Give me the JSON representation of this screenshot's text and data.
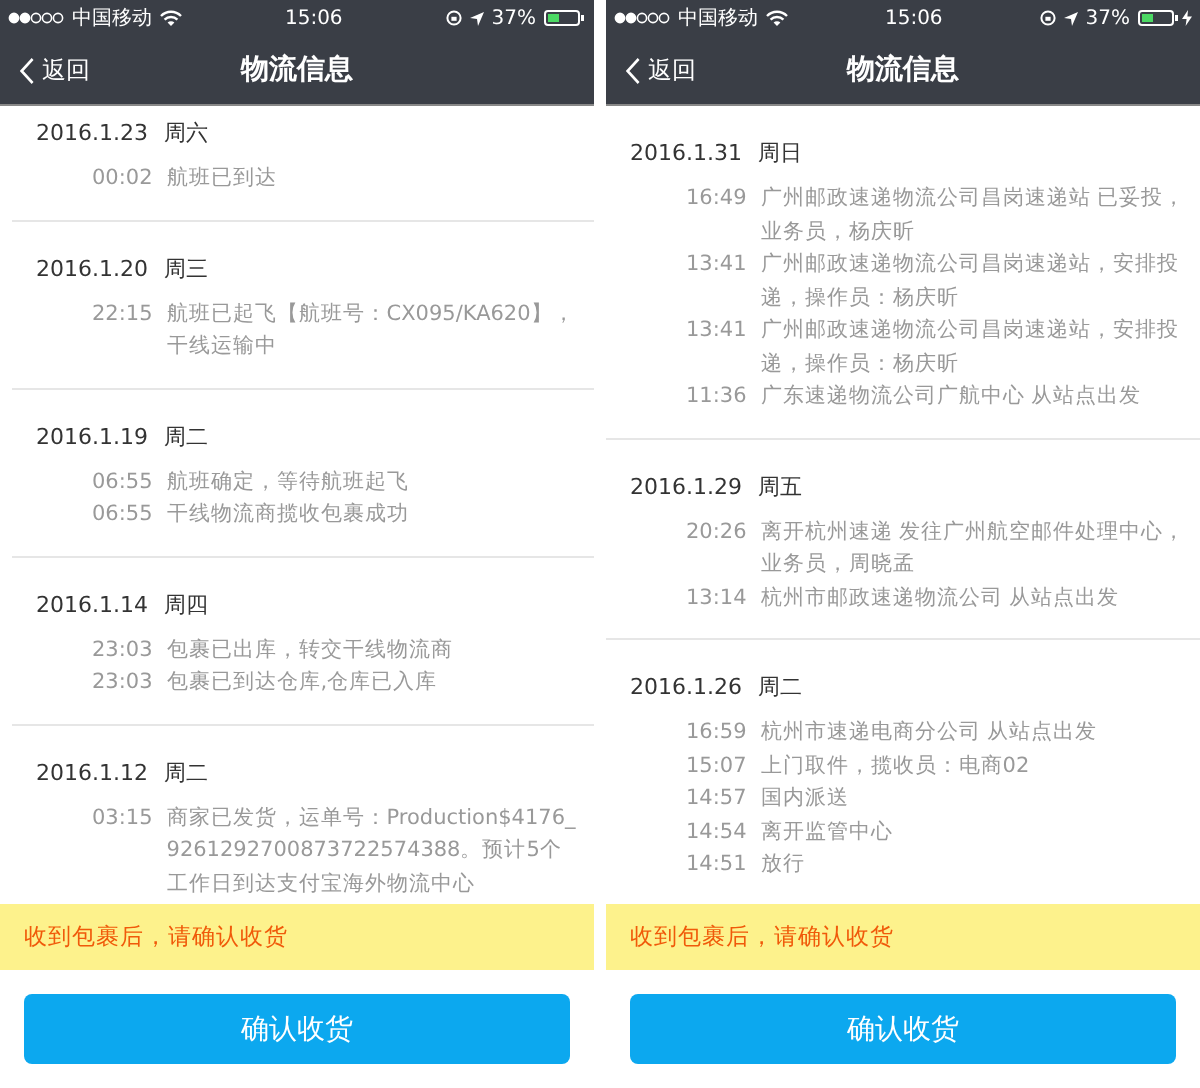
{
  "screens": [
    {
      "status_bar": {
        "carrier": "中国移动",
        "time": "15:06",
        "battery": "37%",
        "charging": false
      },
      "nav": {
        "back": "返回",
        "title": "物流信息"
      },
      "groups": [
        {
          "date": "2016.1.23",
          "weekday": "周六",
          "events": [
            {
              "time": "00:02",
              "text": "航班已到达"
            }
          ]
        },
        {
          "date": "2016.1.20",
          "weekday": "周三",
          "events": [
            {
              "time": "22:15",
              "text": "航班已起飞【航班号：CX095/KA620】，干线运输中"
            }
          ]
        },
        {
          "date": "2016.1.19",
          "weekday": "周二",
          "events": [
            {
              "time": "06:55",
              "text": "航班确定，等待航班起飞"
            },
            {
              "time": "06:55",
              "text": "干线物流商揽收包裹成功"
            }
          ]
        },
        {
          "date": "2016.1.14",
          "weekday": "周四",
          "events": [
            {
              "time": "23:03",
              "text": "包裹已出库，转交干线物流商"
            },
            {
              "time": "23:03",
              "text": "包裹已到达仓库,仓库已入库"
            }
          ]
        },
        {
          "date": "2016.1.12",
          "weekday": "周二",
          "events": [
            {
              "time": "03:15",
              "text": "商家已发货，运单号：Production$4176_9261292700873722574388。预计5个工作日到达支付宝海外物流中心"
            }
          ]
        }
      ],
      "notice": "收到包裹后，请确认收货",
      "button": "确认收货"
    },
    {
      "status_bar": {
        "carrier": "中国移动",
        "time": "15:06",
        "battery": "37%",
        "charging": true
      },
      "nav": {
        "back": "返回",
        "title": "物流信息"
      },
      "groups": [
        {
          "date": "2016.1.31",
          "weekday": "周日",
          "events": [
            {
              "time": "16:49",
              "text": "广州邮政速递物流公司昌岗速递站 已妥投，业务员，杨庆昕"
            },
            {
              "time": "13:41",
              "text": "广州邮政速递物流公司昌岗速递站，安排投递，操作员：杨庆昕"
            },
            {
              "time": "13:41",
              "text": "广州邮政速递物流公司昌岗速递站，安排投递，操作员：杨庆昕"
            },
            {
              "time": "11:36",
              "text": "广东速递物流公司广航中心 从站点出发"
            }
          ]
        },
        {
          "date": "2016.1.29",
          "weekday": "周五",
          "events": [
            {
              "time": "20:26",
              "text": "离开杭州速递 发往广州航空邮件处理中心，业务员，周晓孟"
            },
            {
              "time": "13:14",
              "text": "杭州市邮政速递物流公司 从站点出发"
            }
          ]
        },
        {
          "date": "2016.1.26",
          "weekday": "周二",
          "events": [
            {
              "time": "16:59",
              "text": "杭州市速递电商分公司 从站点出发"
            },
            {
              "time": "15:07",
              "text": "上门取件，揽收员：电商02"
            },
            {
              "time": "14:57",
              "text": "国内派送"
            },
            {
              "time": "14:54",
              "text": "离开监管中心"
            },
            {
              "time": "14:51",
              "text": "放行"
            }
          ]
        }
      ],
      "notice": "收到包裹后，请确认收货",
      "button": "确认收货"
    }
  ]
}
